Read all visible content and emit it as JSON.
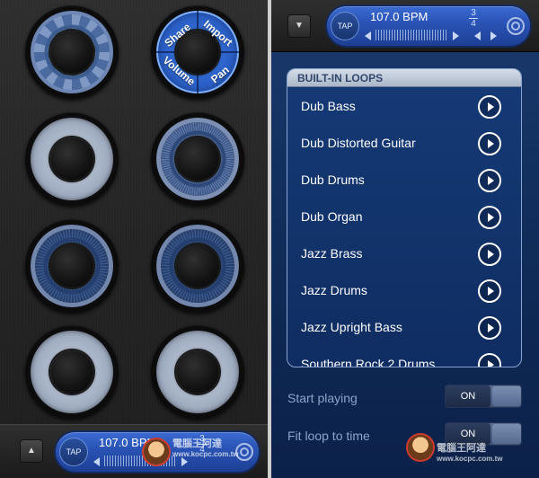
{
  "left": {
    "menu_pad": {
      "share_label": "Share",
      "import_label": "Import",
      "volume_label": "Volume",
      "pan_label": "Pan"
    },
    "bottom_bar": {
      "arrow_label": "▲",
      "tap_label": "TAP",
      "bpm_text": "107.0 BPM",
      "time_sig_top": "3",
      "time_sig_bottom": "4"
    }
  },
  "right": {
    "top_bar": {
      "arrow_label": "▼",
      "tap_label": "TAP",
      "bpm_text": "107.0 BPM",
      "time_sig_top": "3",
      "time_sig_bottom": "4"
    },
    "loops": {
      "header": "BUILT-IN LOOPS",
      "items": [
        {
          "label": "Dub Bass"
        },
        {
          "label": "Dub Distorted Guitar"
        },
        {
          "label": "Dub Drums"
        },
        {
          "label": "Dub Organ"
        },
        {
          "label": "Jazz Brass"
        },
        {
          "label": "Jazz Drums"
        },
        {
          "label": "Jazz Upright Bass"
        },
        {
          "label": "Southern Rock 2 Drums"
        }
      ]
    },
    "settings": {
      "start_playing_label": "Start playing",
      "start_playing_value": "ON",
      "fit_loop_label": "Fit loop to time",
      "fit_loop_value": "ON"
    }
  },
  "watermark": {
    "left_text": "電腦王阿達",
    "left_url": "www.kocpc.com.tw",
    "right_text": "電腦王阿達",
    "right_url": "www.kocpc.com.tw"
  },
  "colors": {
    "accent_blue": "#2a54b6",
    "panel_dark": "#242424",
    "panel_blue": "#12305f",
    "pad_ring": "#a4b0c4"
  }
}
